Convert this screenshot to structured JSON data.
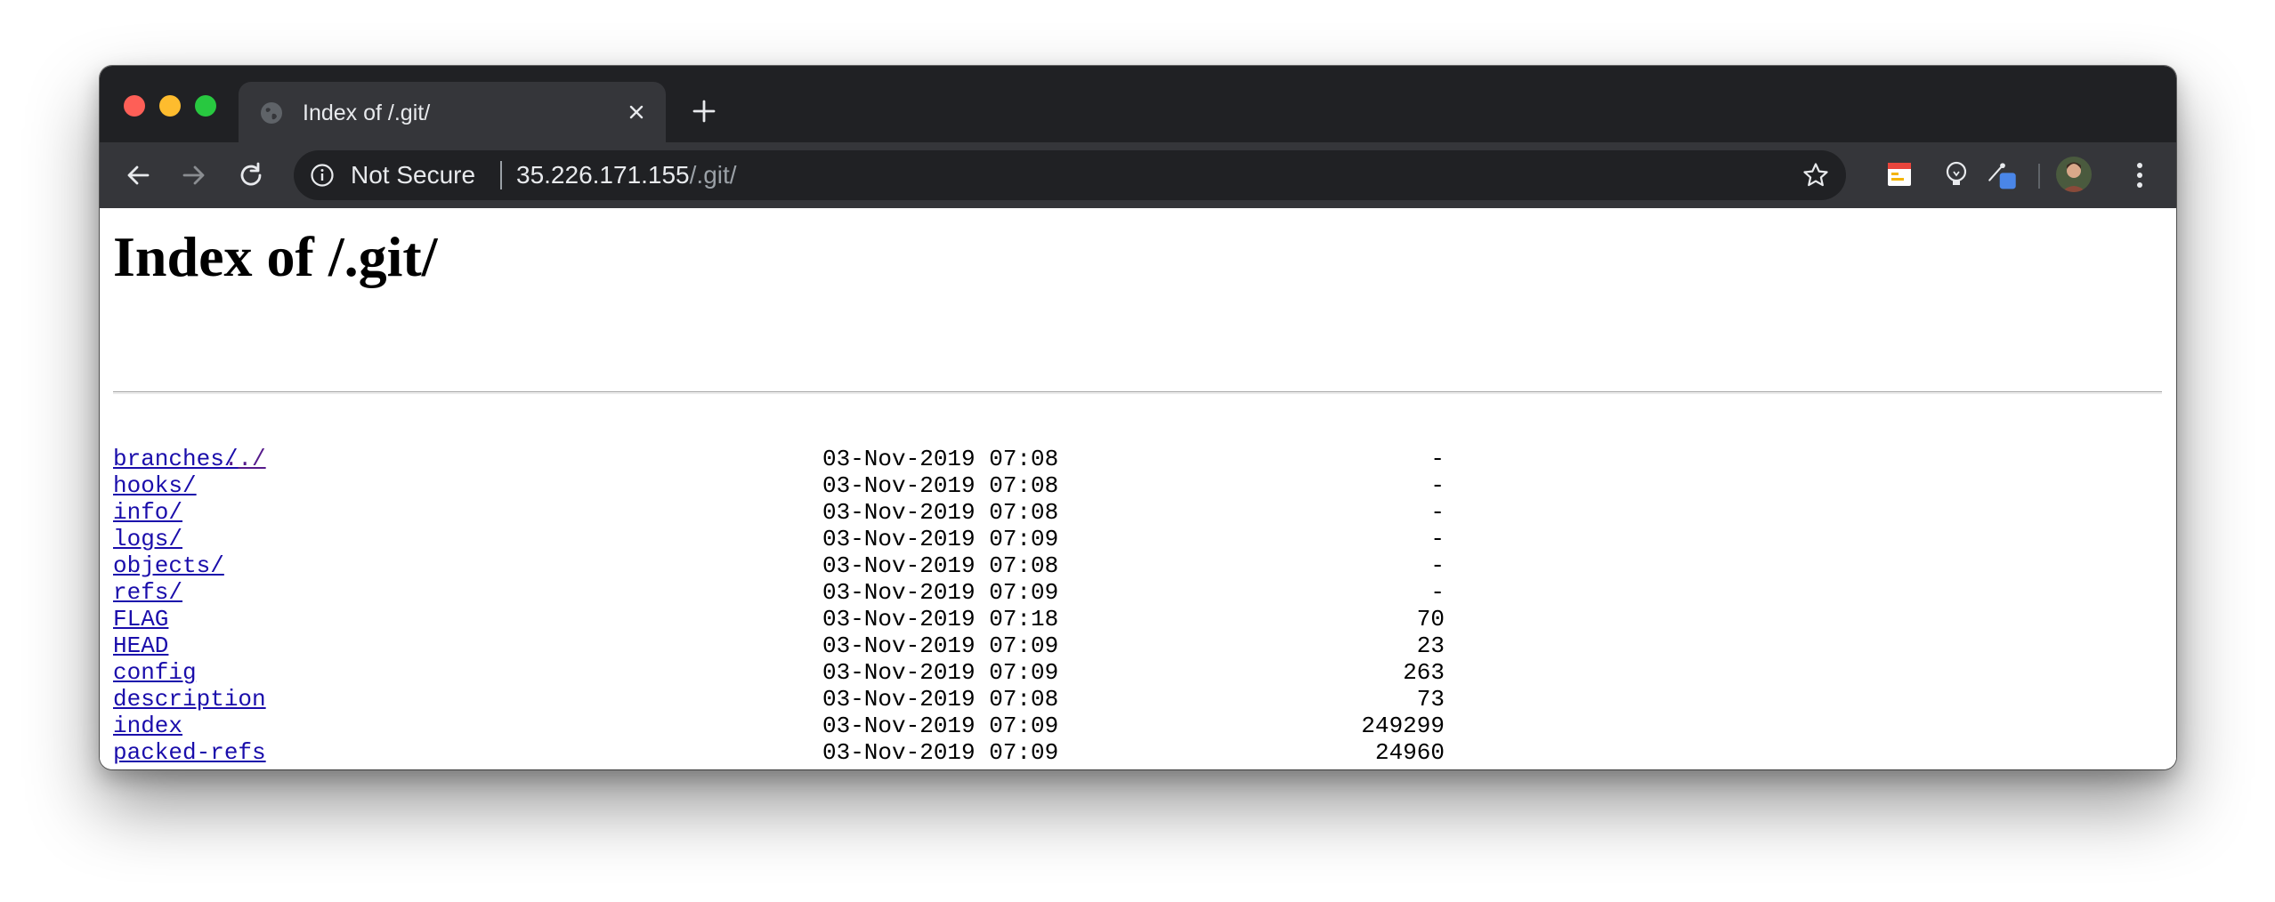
{
  "tab": {
    "title": "Index of /.git/",
    "favicon": "globe-icon"
  },
  "omnibox": {
    "security_label": "Not Secure",
    "url_host": "35.226.171.155",
    "url_path": "/.git/"
  },
  "page": {
    "heading": "Index of /.git/",
    "parent_link": "../",
    "entries": [
      {
        "name": "branches/",
        "date": "03-Nov-2019 07:08",
        "size": "-"
      },
      {
        "name": "hooks/",
        "date": "03-Nov-2019 07:08",
        "size": "-"
      },
      {
        "name": "info/",
        "date": "03-Nov-2019 07:08",
        "size": "-"
      },
      {
        "name": "logs/",
        "date": "03-Nov-2019 07:09",
        "size": "-"
      },
      {
        "name": "objects/",
        "date": "03-Nov-2019 07:08",
        "size": "-"
      },
      {
        "name": "refs/",
        "date": "03-Nov-2019 07:09",
        "size": "-"
      },
      {
        "name": "FLAG",
        "date": "03-Nov-2019 07:18",
        "size": "70"
      },
      {
        "name": "HEAD",
        "date": "03-Nov-2019 07:09",
        "size": "23"
      },
      {
        "name": "config",
        "date": "03-Nov-2019 07:09",
        "size": "263"
      },
      {
        "name": "description",
        "date": "03-Nov-2019 07:08",
        "size": "73"
      },
      {
        "name": "index",
        "date": "03-Nov-2019 07:09",
        "size": "249299"
      },
      {
        "name": "packed-refs",
        "date": "03-Nov-2019 07:09",
        "size": "24960"
      }
    ]
  },
  "colors": {
    "link": "#1a0dab",
    "visited_link": "#551a8b",
    "titlebar": "#202124",
    "toolbar": "#35363a"
  }
}
